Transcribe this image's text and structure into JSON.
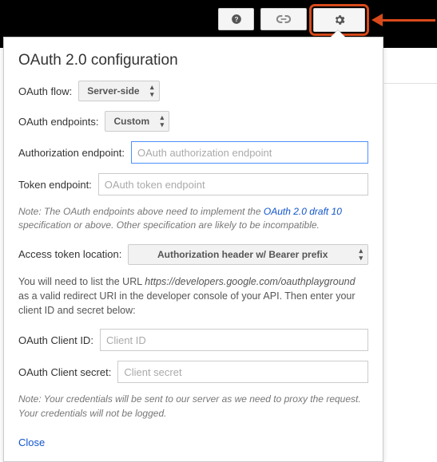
{
  "topbar": {
    "help_icon": "help",
    "link_icon": "link",
    "gear_icon": "settings"
  },
  "panel": {
    "title": "OAuth 2.0 configuration",
    "flow_label": "OAuth flow:",
    "flow_value": "Server-side",
    "endpoints_label": "OAuth endpoints:",
    "endpoints_value": "Custom",
    "auth_endpoint_label": "Authorization endpoint:",
    "auth_endpoint_placeholder": "OAuth authorization endpoint",
    "auth_endpoint_value": "",
    "token_endpoint_label": "Token endpoint:",
    "token_endpoint_placeholder": "OAuth token endpoint",
    "token_endpoint_value": "",
    "note1_prefix": "Note: The OAuth endpoints above need to implement the ",
    "note1_link": "OAuth 2.0 draft 10",
    "note1_suffix": " specification or above. Other specification are likely to be incompatible.",
    "access_token_label": "Access token location:",
    "access_token_value": "Authorization header w/ Bearer prefix",
    "redirect_info_prefix": "You will need to list the URL ",
    "redirect_info_url": "https://developers.google.com/oauthplayground",
    "redirect_info_suffix": " as a valid redirect URI in the developer console of your API. Then enter your client ID and secret below:",
    "client_id_label": "OAuth Client ID:",
    "client_id_placeholder": "Client ID",
    "client_id_value": "",
    "client_secret_label": "OAuth Client secret:",
    "client_secret_placeholder": "Client secret",
    "client_secret_value": "",
    "note2": "Note: Your credentials will be sent to our server as we need to proxy the request. Your credentials will not be logged.",
    "close_label": "Close"
  }
}
